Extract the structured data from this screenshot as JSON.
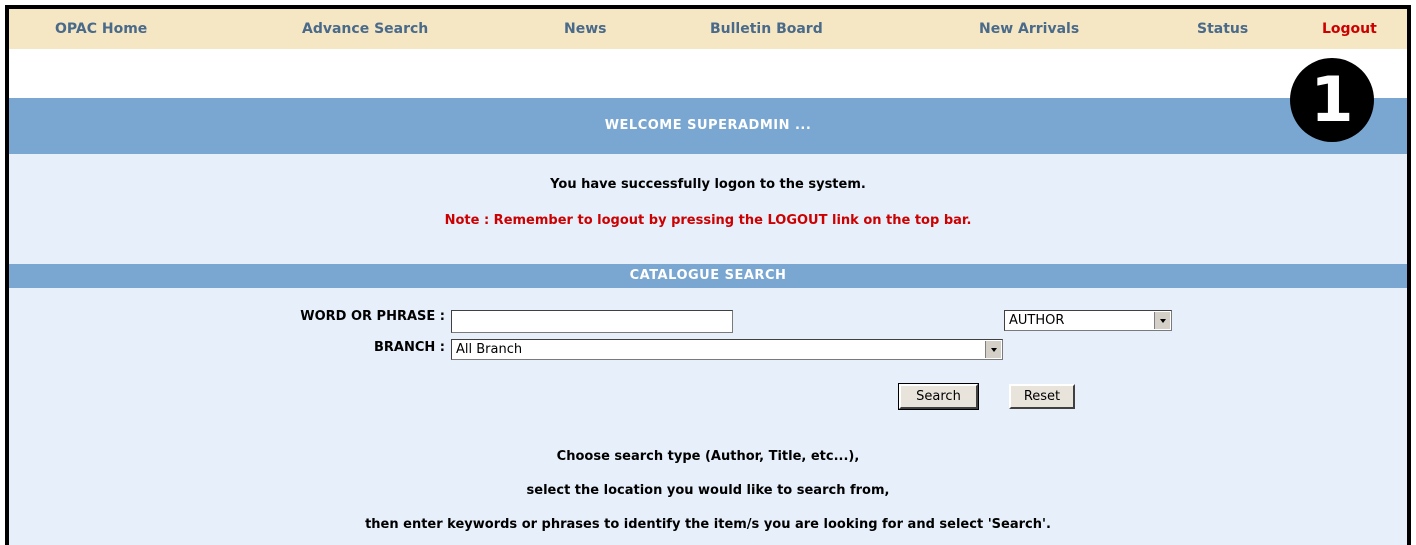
{
  "nav": {
    "items": [
      "OPAC Home",
      "Advance Search",
      "News",
      "Bulletin Board",
      "New Arrivals",
      "Status"
    ],
    "logout": "Logout"
  },
  "welcome": {
    "title": "WELCOME SUPERADMIN ...",
    "message": "You have successfully logon to the system.",
    "note": "Note : Remember to logout by pressing the LOGOUT link on the top bar."
  },
  "catalogue": {
    "title": "CATALOGUE SEARCH",
    "word_label": "WORD OR PHRASE :",
    "word_value": "",
    "type_select": "AUTHOR",
    "branch_label": "BRANCH :",
    "branch_select": "All Branch",
    "search_button": "Search",
    "reset_button": "Reset",
    "help": [
      "Choose search type (Author, Title, etc...),",
      "select the location you would like to search from,",
      "then enter keywords or phrases to identify the item/s you are looking for and select 'Search'."
    ]
  },
  "callout_number": "1",
  "colors": {
    "nav_bg": "#f5e6c4",
    "band": "#7aa7d1",
    "panel": "#e6effa",
    "note": "#cc0000"
  }
}
